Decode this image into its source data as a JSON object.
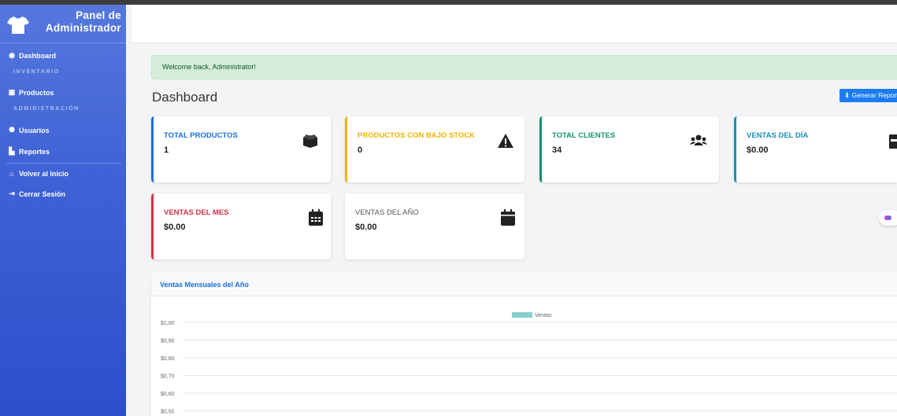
{
  "sidebar": {
    "brand": "Panel de\nAdministrador",
    "items": [
      {
        "label": "Dashboard",
        "icon": "dashboard-icon"
      },
      {
        "label": "Productos",
        "icon": "box-icon"
      },
      {
        "label": "Usuarios",
        "icon": "users-icon"
      },
      {
        "label": "Reportes",
        "icon": "chart-icon"
      },
      {
        "label": "Volver al Inicio",
        "icon": "home-icon"
      },
      {
        "label": "Cerrar Sesión",
        "icon": "logout-icon"
      }
    ],
    "sections": [
      "INVENTARIO",
      "ADMINISTRACIÓN"
    ]
  },
  "alert": {
    "text": "Welcome back, Administrator!"
  },
  "page": {
    "title": "Dashboard",
    "report_button": "⬇ Generar Reporte"
  },
  "cards": [
    {
      "label": "TOTAL PRODUCTOS",
      "value": "1",
      "color": "#1b6fd8",
      "icon": "boxes-icon"
    },
    {
      "label": "PRODUCTOS CON BAJO STOCK",
      "value": "0",
      "color": "#f0b400",
      "icon": "warning-icon"
    },
    {
      "label": "TOTAL CLIENTES",
      "value": "34",
      "color": "#14936d",
      "icon": "users-icon"
    },
    {
      "label": "VENTAS DEL DÍA",
      "value": "$0.00",
      "color": "#1b8fb8",
      "icon": "calendar-day-icon"
    },
    {
      "label": "VENTAS DEL MES",
      "value": "$0.00",
      "color": "#d63347",
      "icon": "calendar-grid-icon"
    },
    {
      "label": "VENTAS DEL AÑO",
      "value": "$0.00",
      "color": "#555555",
      "icon": "calendar-icon"
    }
  ],
  "chart": {
    "title": "Ventas Mensuales del Año"
  },
  "chart_data": {
    "type": "bar",
    "series": [
      {
        "name": "Ventas",
        "values": []
      }
    ],
    "ylim": [
      0.5,
      1.0
    ],
    "yticks": [
      "$1,00",
      "$0,90",
      "$0,80",
      "$0,70",
      "$0,60",
      "$0,50"
    ],
    "legend": "top-center",
    "grid": true,
    "color": "#88d0d0"
  }
}
